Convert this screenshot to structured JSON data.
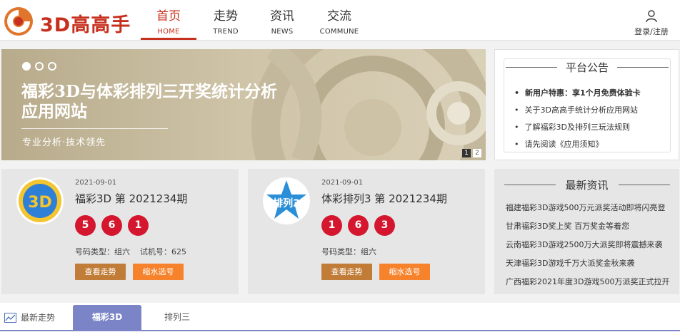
{
  "header": {
    "logo_text": "3D高高手",
    "nav": [
      {
        "cn": "首页",
        "en": "HOME"
      },
      {
        "cn": "走势",
        "en": "TREND"
      },
      {
        "cn": "资讯",
        "en": "NEWS"
      },
      {
        "cn": "交流",
        "en": "COMMUNE"
      }
    ],
    "user_label": "登录/注册",
    "accent_color": "#c7301e"
  },
  "banner": {
    "title": "福彩3D与体彩排列三开奖统计分析应用网站",
    "subtitle": "专业分析·技术领先",
    "slide_count": 3,
    "active_slide": 1,
    "pager": [
      "1",
      "2"
    ]
  },
  "notice": {
    "title": "平台公告",
    "items": [
      "新用户特惠：享1个月免费体验卡",
      "关于3D高高手统计分析应用网站",
      "了解福彩3D及排列三玩法规则",
      "请先阅读《应用须知》"
    ]
  },
  "cards": [
    {
      "date": "2021-09-01",
      "issue": "福彩3D 第 2021234期",
      "balls": [
        "5",
        "6",
        "1"
      ],
      "type_label": "号码类型：组六",
      "machine_label": "试机号：625",
      "btn_trend": "查看走势",
      "btn_pick": "缩水选号",
      "icon": "fucai-3d-logo"
    },
    {
      "date": "2021-09-01",
      "issue": "体彩排列3 第 2021234期",
      "balls": [
        "1",
        "6",
        "3"
      ],
      "type_label": "号码类型：组六",
      "btn_trend": "查看走势",
      "btn_pick": "缩水选号",
      "icon": "pailie3-logo",
      "icon_text": "排列3"
    }
  ],
  "news": {
    "title": "最新资讯",
    "items": [
      "福建福彩3D游戏500万元派奖活动即将闪亮登",
      "甘肃福彩3D奖上奖 百万奖金等着您",
      "云南福彩3D游戏2500万大派奖即将震撼来袭",
      "天津福彩3D游戏千万大派奖金秋来袭",
      "广西福彩2021年度3D游戏500万派奖正式拉开"
    ]
  },
  "tabs": {
    "trend_label": "最新走势",
    "items": [
      "福彩3D",
      "排列三"
    ],
    "active_color": "#7a84c6"
  }
}
